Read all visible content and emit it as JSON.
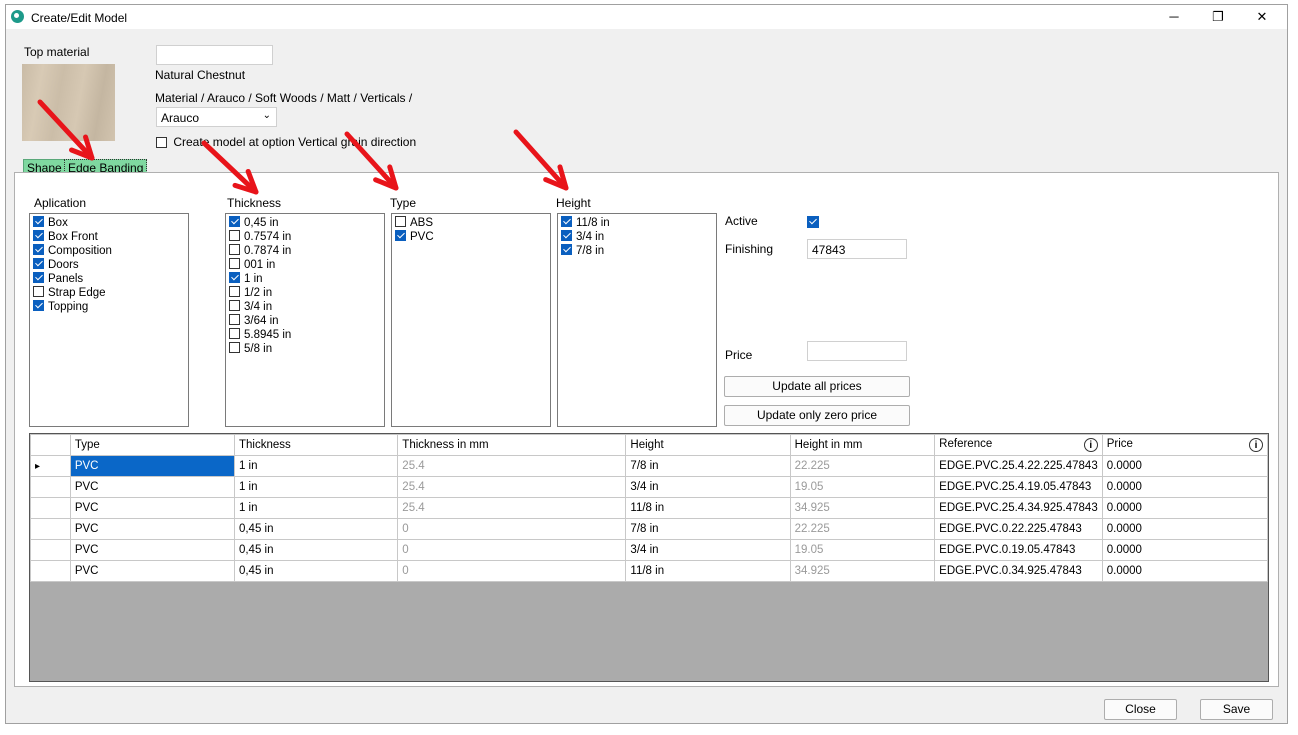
{
  "window": {
    "title": "Create/Edit Model",
    "minimize": "─",
    "maximize": "❐",
    "close": "✕"
  },
  "top_material": {
    "label": "Top material",
    "name_input": "",
    "name": "Natural Chestnut",
    "path": "Material  / Arauco / Soft Woods / Matt / Verticals /",
    "brand_selected": "Arauco",
    "vertical_option_label": "Create model at option Vertical grain direction",
    "vertical_option_checked": false
  },
  "tabs": {
    "shape": "Shape",
    "edge_banding": "Edge Banding"
  },
  "aplication": {
    "label": "Aplication",
    "items": [
      {
        "label": "Box",
        "checked": true
      },
      {
        "label": "Box Front",
        "checked": true
      },
      {
        "label": "Composition",
        "checked": true
      },
      {
        "label": "Doors",
        "checked": true
      },
      {
        "label": "Panels",
        "checked": true
      },
      {
        "label": "Strap Edge",
        "checked": false
      },
      {
        "label": "Topping",
        "checked": true
      }
    ]
  },
  "thickness": {
    "label": "Thickness",
    "items": [
      {
        "label": "0,45 in",
        "checked": true
      },
      {
        "label": "0.7574 in",
        "checked": false
      },
      {
        "label": "0.7874 in",
        "checked": false
      },
      {
        "label": "001 in",
        "checked": false
      },
      {
        "label": "1 in",
        "checked": true
      },
      {
        "label": "1/2 in",
        "checked": false
      },
      {
        "label": "3/4 in",
        "checked": false
      },
      {
        "label": "3/64 in",
        "checked": false
      },
      {
        "label": "5.8945 in",
        "checked": false
      },
      {
        "label": "5/8 in",
        "checked": false
      }
    ]
  },
  "type": {
    "label": "Type",
    "items": [
      {
        "label": "ABS",
        "checked": false
      },
      {
        "label": "PVC",
        "checked": true
      }
    ]
  },
  "height": {
    "label": "Height",
    "items": [
      {
        "label": "11/8 in",
        "checked": true
      },
      {
        "label": "3/4 in",
        "checked": true
      },
      {
        "label": "7/8 in",
        "checked": true
      }
    ]
  },
  "settings": {
    "active_label": "Active",
    "active_checked": true,
    "finishing_label": "Finishing",
    "finishing_value": "47843",
    "price_label": "Price",
    "price_value": "",
    "update_all_label": "Update all prices",
    "update_zero_label": "Update only zero price"
  },
  "grid": {
    "headers": [
      "Type",
      "Thickness",
      "Thickness in mm",
      "Height",
      "Height in mm",
      "Reference",
      "Price"
    ],
    "rows": [
      [
        "PVC",
        "1 in",
        "25.4",
        "7/8 in",
        "22.225",
        "EDGE.PVC.25.4.22.225.47843",
        "0.0000"
      ],
      [
        "PVC",
        "1 in",
        "25.4",
        "3/4 in",
        "19.05",
        "EDGE.PVC.25.4.19.05.47843",
        "0.0000"
      ],
      [
        "PVC",
        "1 in",
        "25.4",
        "11/8 in",
        "34.925",
        "EDGE.PVC.25.4.34.925.47843",
        "0.0000"
      ],
      [
        "PVC",
        "0,45 in",
        "0",
        "7/8 in",
        "22.225",
        "EDGE.PVC.0.22.225.47843",
        "0.0000"
      ],
      [
        "PVC",
        "0,45 in",
        "0",
        "3/4 in",
        "19.05",
        "EDGE.PVC.0.19.05.47843",
        "0.0000"
      ],
      [
        "PVC",
        "0,45 in",
        "0",
        "11/8 in",
        "34.925",
        "EDGE.PVC.0.34.925.47843",
        "0.0000"
      ]
    ],
    "current_row_marker": "▸",
    "info_glyph": "i"
  },
  "footer": {
    "close_label": "Close",
    "save_label": "Save"
  },
  "colors": {
    "accent_blue": "#0a67c8",
    "tab_green": "#7fd8a0",
    "arrow_red": "#e8141a"
  }
}
